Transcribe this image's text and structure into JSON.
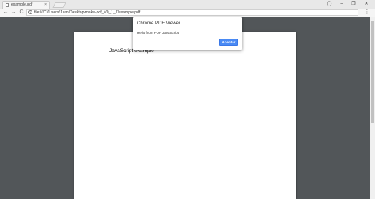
{
  "tab": {
    "title": "example.pdf",
    "close": "×"
  },
  "window_controls": {
    "minimize": "–",
    "maximize": "❐",
    "close": "✕"
  },
  "toolbar": {
    "back": "←",
    "forward": "→",
    "reload": "C",
    "url": "file:///C:/Users/Juan/Desktop/make-pdf_V0_1_7/example.pdf",
    "star": "☆",
    "menu": "⋮"
  },
  "pdf": {
    "text": "JavaScript example"
  },
  "dialog": {
    "title": "Chrome PDF Viewer",
    "message": "Hello from PDF JavaScript",
    "button": "Aceptar"
  },
  "colors": {
    "viewer_bg": "#525659",
    "accent": "#4a8af4"
  }
}
